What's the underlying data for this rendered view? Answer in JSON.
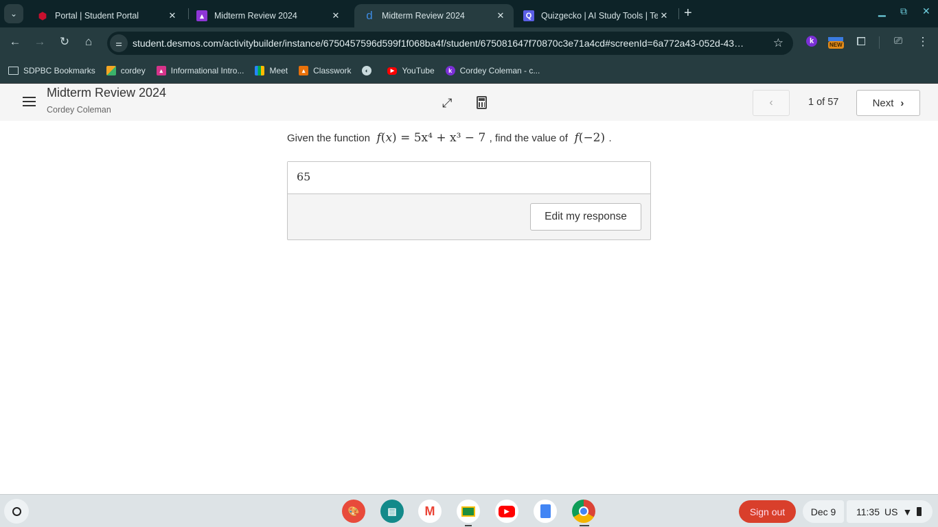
{
  "browser": {
    "tabs": [
      {
        "title": "Portal | Student Portal",
        "icon": "portal-icon",
        "active": false
      },
      {
        "title": "Midterm Review 2024",
        "icon": "classroom-icon",
        "active": false
      },
      {
        "title": "Midterm Review 2024",
        "icon": "desmos-icon",
        "active": true
      },
      {
        "title": "Quizgecko | AI Study Tools | Tes",
        "icon": "quizgecko-icon",
        "active": false
      }
    ],
    "url": "student.desmos.com/activitybuilder/instance/6750457596d599f1f068ba4f/student/675081647f70870c3e71a4cd#screenId=6a772a43-052d-43…",
    "extension_badge": "NEW",
    "bookmarks": [
      {
        "label": "SDPBC Bookmarks",
        "icon": "folder-icon"
      },
      {
        "label": "cordey",
        "icon": "cube-icon"
      },
      {
        "label": "Informational Intro...",
        "icon": "classroom-icon"
      },
      {
        "label": "Meet",
        "icon": "meet-icon"
      },
      {
        "label": "Classwork",
        "icon": "classroom-icon"
      },
      {
        "label": "",
        "icon": "globe-icon"
      },
      {
        "label": "YouTube",
        "icon": "youtube-icon"
      },
      {
        "label": "Cordey Coleman - c...",
        "icon": "k-icon"
      }
    ]
  },
  "activity": {
    "title": "Midterm Review 2024",
    "student": "Cordey Coleman",
    "page_indicator": "1 of 57",
    "next_label": "Next"
  },
  "question": {
    "prefix": "Given the function",
    "function_lhs": "f",
    "function_var": "x",
    "function_rhs": "5x⁴ + x³ − 7",
    "middle": ", find the value of",
    "eval_arg": "−2",
    "suffix": "."
  },
  "response": {
    "value": "65",
    "edit_label": "Edit my response"
  },
  "shelf": {
    "apps": [
      "canvas-icon",
      "screencast-icon",
      "gmail-icon",
      "classroom-icon",
      "youtube-icon",
      "docs-icon",
      "chrome-icon"
    ],
    "sign_out": "Sign out",
    "date": "Dec 9",
    "time": "11:35",
    "locale": "US"
  },
  "colors": {
    "sign_out": "#d93f2b",
    "browser_frame": "#0d2328"
  }
}
